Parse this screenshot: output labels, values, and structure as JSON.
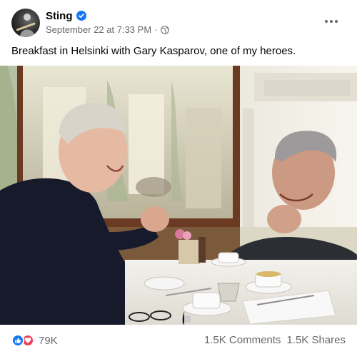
{
  "post": {
    "author": "Sting",
    "timestamp": "September 22 at 7:33 PM",
    "separator": "·",
    "audience_icon": "globe-icon",
    "text": "Breakfast in Helsinki with Gary Kasparov, one of my heroes.",
    "photo_description_icon": "photo"
  },
  "footer": {
    "reaction_count": "79K",
    "comments": "1.5K Comments",
    "shares": "1.5K Shares",
    "reaction_icons": [
      "like-icon",
      "love-icon"
    ]
  },
  "colors": {
    "verified": "#1877f2",
    "secondary_text": "#65676b",
    "like": "#1877f2",
    "love": "#f33e58"
  }
}
